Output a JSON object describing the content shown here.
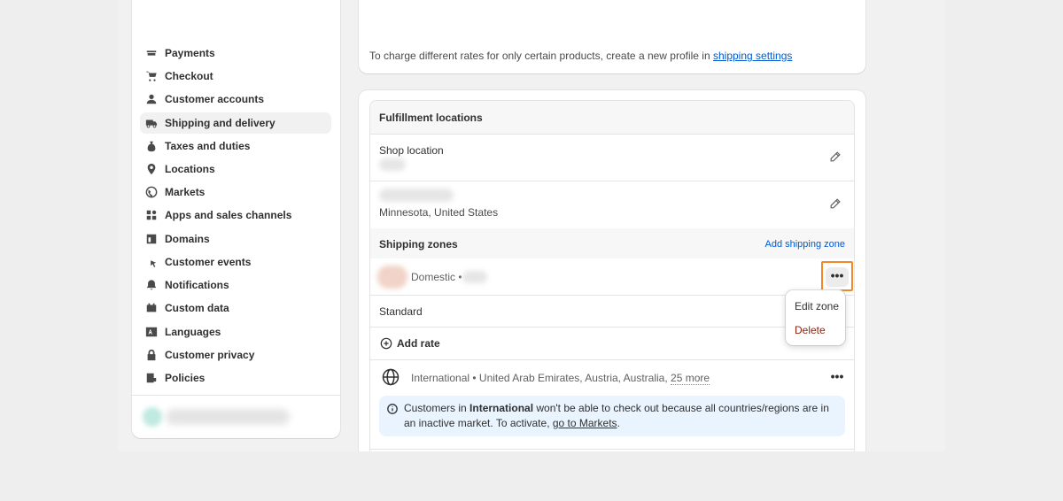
{
  "sidebar": {
    "items": [
      {
        "label": "Payments",
        "icon": "payments-icon"
      },
      {
        "label": "Checkout",
        "icon": "cart-icon"
      },
      {
        "label": "Customer accounts",
        "icon": "person-icon"
      },
      {
        "label": "Shipping and delivery",
        "icon": "truck-icon",
        "active": true
      },
      {
        "label": "Taxes and duties",
        "icon": "tax-bag-icon"
      },
      {
        "label": "Locations",
        "icon": "location-pin-icon"
      },
      {
        "label": "Markets",
        "icon": "globe-icon"
      },
      {
        "label": "Apps and sales channels",
        "icon": "apps-icon"
      },
      {
        "label": "Domains",
        "icon": "domain-icon"
      },
      {
        "label": "Customer events",
        "icon": "cursor-icon"
      },
      {
        "label": "Notifications",
        "icon": "bell-icon"
      },
      {
        "label": "Custom data",
        "icon": "custom-data-icon"
      },
      {
        "label": "Languages",
        "icon": "language-icon"
      },
      {
        "label": "Customer privacy",
        "icon": "lock-icon"
      },
      {
        "label": "Policies",
        "icon": "policies-icon"
      }
    ]
  },
  "top_card": {
    "text": "To charge different rates for only certain products, create a new profile in ",
    "link": "shipping settings"
  },
  "fulfillment": {
    "title": "Fulfillment locations",
    "shop_location_label": "Shop location",
    "second_location_address": "Minnesota, United States"
  },
  "shipping_zones": {
    "title": "Shipping zones",
    "add_link": "Add shipping zone",
    "domestic": {
      "name": "Domestic •",
      "rate_name": "Standard",
      "add_rate": "Add rate"
    },
    "more_label": "•••",
    "menu": {
      "edit": "Edit zone",
      "delete": "Delete"
    },
    "international": {
      "name": "International • United Arab Emirates, Austria, Australia,",
      "more_count": "25 more"
    },
    "banner": {
      "prefix": "Customers in ",
      "bold": "International",
      "middle": " won't be able to check out because all countries/regions are in an inactive market. To activate, ",
      "link": "go to Markets",
      "suffix": "."
    }
  },
  "colors": {
    "accent_link": "#005bd3",
    "highlight_border": "#f08a28",
    "danger": "#8e1f0b",
    "banner_bg": "#eaf4ff"
  }
}
